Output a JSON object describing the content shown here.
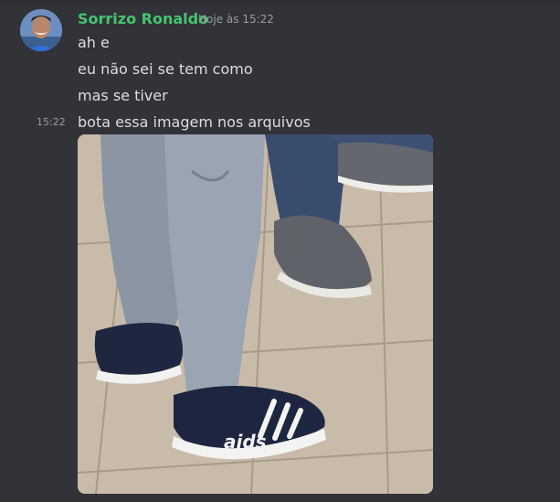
{
  "message": {
    "author": "Sorrizo Ronaldo",
    "timestamp": "Hoje às 15:22",
    "lines": [
      "ah e",
      "eu não sei se tem como",
      "mas se tiver",
      "bota essa imagem nos arquivos"
    ],
    "hover_timestamp": "15:22",
    "shoe_text": "aids"
  },
  "colors": {
    "background": "#323339",
    "username": "#46c46e",
    "text": "#dbdee1",
    "muted": "#9a9ca3"
  }
}
